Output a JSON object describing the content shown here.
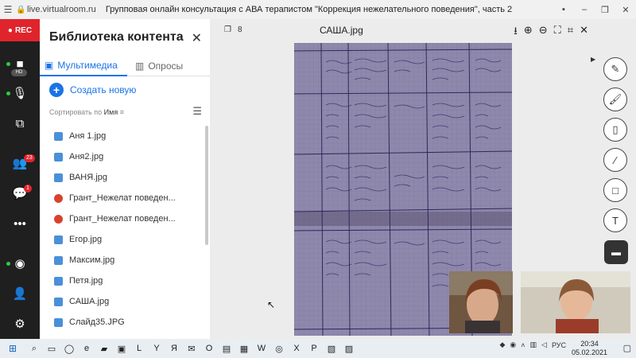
{
  "browser": {
    "url": "live.virtualroom.ru",
    "title": "Групповая онлайн консультация с АВА терапистом \"Коррекция нежелательного поведения\", часть 2"
  },
  "rail": {
    "rec_label": "REC",
    "hd_label": "HD",
    "participants_badge": "23",
    "chat_badge": "1"
  },
  "library": {
    "title": "Библиотека контента",
    "tabs": [
      {
        "label": "Мультимедиа",
        "active": true
      },
      {
        "label": "Опросы",
        "active": false
      }
    ],
    "create_label": "Создать новую",
    "sort_prefix": "Сортировать по",
    "sort_value": "Имя",
    "files": [
      {
        "name": "Аня 1.jpg",
        "icon": "image-file-icon"
      },
      {
        "name": "Аня2.jpg",
        "icon": "image-file-icon"
      },
      {
        "name": "ВАНЯ.jpg",
        "icon": "image-file-icon"
      },
      {
        "name": "Грант_Нежелат поведен...",
        "icon": "document-file-icon"
      },
      {
        "name": "Грант_Нежелат поведен...",
        "icon": "document-file-icon"
      },
      {
        "name": "Егор.jpg",
        "icon": "image-file-icon"
      },
      {
        "name": "Максим.jpg",
        "icon": "image-file-icon"
      },
      {
        "name": "Петя.jpg",
        "icon": "image-file-icon"
      },
      {
        "name": "САША.jpg",
        "icon": "image-file-icon"
      },
      {
        "name": "Слайд35.JPG",
        "icon": "image-file-icon"
      }
    ]
  },
  "viewer": {
    "page_count": "8",
    "file_name": "САША.jpg"
  },
  "taskbar": {
    "lang": "РУС",
    "time": "20:34",
    "date": "05.02.2021"
  },
  "colors": {
    "accent": "#1a73e8",
    "rec": "#e0242c",
    "rail": "#1f1f1f"
  }
}
